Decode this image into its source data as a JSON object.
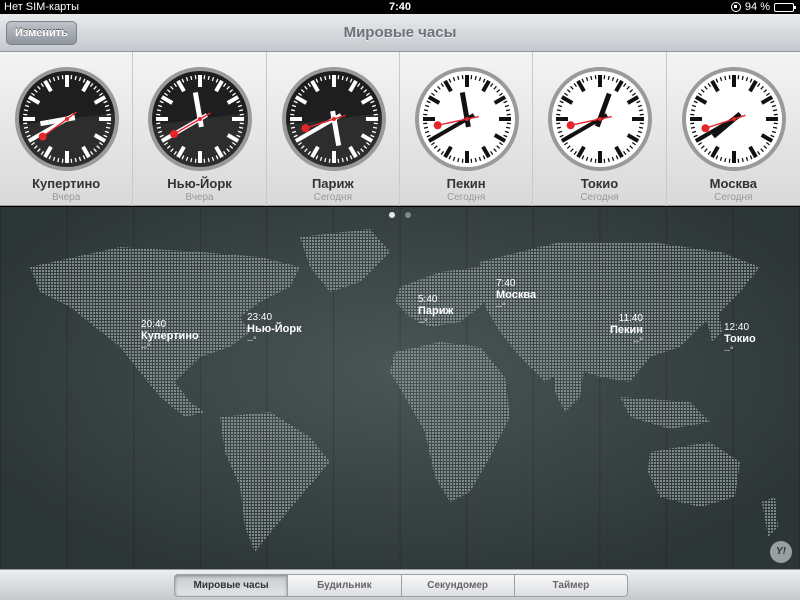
{
  "status_bar": {
    "carrier": "Нет SIM-карты",
    "time": "7:40",
    "battery": "94 %",
    "battery_level": 0.94
  },
  "nav": {
    "edit_label": "Изменить",
    "title": "Мировые часы"
  },
  "clocks": [
    {
      "city": "Купертино",
      "day": "Вчера",
      "hour": 20,
      "minute": 40,
      "second": 39,
      "dark": true
    },
    {
      "city": "Нью-Йорк",
      "day": "Вчера",
      "hour": 23,
      "minute": 40,
      "second": 40,
      "dark": true
    },
    {
      "city": "Париж",
      "day": "Сегодня",
      "hour": 5,
      "minute": 40,
      "second": 42,
      "dark": true
    },
    {
      "city": "Пекин",
      "day": "Сегодня",
      "hour": 11,
      "minute": 40,
      "second": 43,
      "dark": false
    },
    {
      "city": "Токио",
      "day": "Сегодня",
      "hour": 12,
      "minute": 40,
      "second": 43,
      "dark": false
    },
    {
      "city": "Москва",
      "day": "Сегодня",
      "hour": 7,
      "minute": 40,
      "second": 42,
      "dark": false
    }
  ],
  "map": {
    "page_count": 2,
    "current_page": 1,
    "markers": [
      {
        "time": "20:40",
        "city": "Купертино",
        "temp": "--°"
      },
      {
        "time": "23:40",
        "city": "Нью-Йорк",
        "temp": "--°"
      },
      {
        "time": "5:40",
        "city": "Париж",
        "temp": "--°"
      },
      {
        "time": "7:40",
        "city": "Москва",
        "temp": "--°"
      },
      {
        "time": "11:40",
        "city": "Пекин",
        "temp": "--°"
      },
      {
        "time": "12:40",
        "city": "Токио",
        "temp": "--°"
      }
    ],
    "badge": "Y!"
  },
  "tabs": [
    {
      "label": "Мировые часы",
      "active": true
    },
    {
      "label": "Будильник",
      "active": false
    },
    {
      "label": "Секундомер",
      "active": false
    },
    {
      "label": "Таймер",
      "active": false
    }
  ],
  "colors": {
    "second_hand": "#e8242b",
    "dark_face": "#1e1e1e",
    "light_face": "#ffffff"
  }
}
